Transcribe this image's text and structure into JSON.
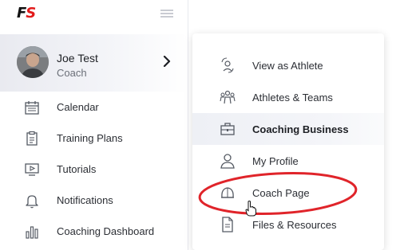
{
  "logo": {
    "letter_f": "F",
    "letter_s": "S"
  },
  "colors": {
    "accent_red": "#e21b1b",
    "annotation_red": "#e0242a",
    "sidebar_active_bg": "#eceef3"
  },
  "profile": {
    "name": "Joe Test",
    "role": "Coach"
  },
  "sidebar": {
    "items": [
      {
        "label": "Calendar",
        "icon": "calendar-icon"
      },
      {
        "label": "Training Plans",
        "icon": "clipboard-icon"
      },
      {
        "label": "Tutorials",
        "icon": "monitor-play-icon"
      },
      {
        "label": "Notifications",
        "icon": "bell-icon"
      },
      {
        "label": "Coaching Dashboard",
        "icon": "bar-chart-icon"
      }
    ]
  },
  "dropdown": {
    "items": [
      {
        "label": "View as Athlete",
        "icon": "swap-user-icon"
      },
      {
        "label": "Athletes & Teams",
        "icon": "team-icon"
      },
      {
        "label": "Coaching Business",
        "icon": "briefcase-icon",
        "active": true
      },
      {
        "label": "My Profile",
        "icon": "user-icon"
      },
      {
        "label": "Coach Page",
        "icon": "coach-helmet-icon"
      },
      {
        "label": "Files & Resources",
        "icon": "file-icon"
      }
    ]
  }
}
